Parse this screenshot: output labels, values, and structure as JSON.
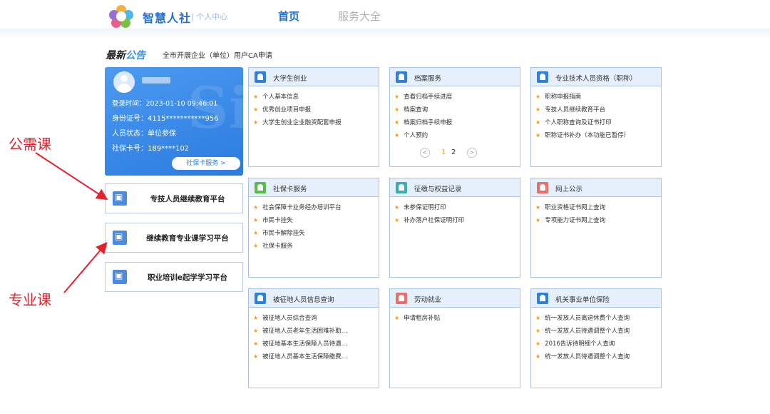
{
  "header": {
    "brand": "智慧人社",
    "sub": "| 个人中心",
    "nav_home": "首页",
    "nav_all": "服务大全"
  },
  "notice": {
    "title_a": "最新",
    "title_b": "公告",
    "text": "全市开展企业（单位）用户CA申请"
  },
  "user": {
    "login_time": "登录时间：2023-01-10 09:46:01",
    "id_no": "身份证号：4115***********956",
    "status": "人员状态：单位参保",
    "card_no": "社保卡号：189****102",
    "card_service": "社保卡服务 >"
  },
  "platforms": [
    "专技人员继续教育平台",
    "继续教育专业课学习平台",
    "职业培训e起学学习平台"
  ],
  "cards": [
    {
      "title": "大学生创业",
      "icon_color": "#2f7fd8",
      "items": [
        "个人基本信息",
        "优秀创业项目申报",
        "大学生创业企业融资配套申报"
      ]
    },
    {
      "title": "档案服务",
      "icon_color": "#2f7fd8",
      "items": [
        "查看归档手续进度",
        "档案查询",
        "档案归档手续申报",
        "个人预约"
      ],
      "pager": [
        "1",
        "2"
      ]
    },
    {
      "title": "专业技术人员资格（职称）",
      "icon_color": "#2f7fd8",
      "items": [
        "职称申报指南",
        "专技人员继续教育平台",
        "个人职称查询及证书打印",
        "职称证书补办（本功能已暂停）"
      ]
    },
    {
      "title": "社保卡服务",
      "icon_color": "#5bbb4a",
      "items": [
        "社会保障卡业务经办培训平台",
        "市民卡挂失",
        "市民卡解除挂失",
        "社保卡服务"
      ]
    },
    {
      "title": "征缴与权益记录",
      "icon_color": "#3aaeae",
      "items": [
        "未参保证明打印",
        "补办落户社保证明打印"
      ]
    },
    {
      "title": "网上公示",
      "icon_color": "#e9706a",
      "items": [
        "职业资格证书网上查询",
        "专项能力证书网上查询"
      ]
    },
    {
      "title": "被征地人员信息查询",
      "icon_color": "#2f7fd8",
      "items": [
        "被征地人员综合查询",
        "被征地人员老年生活困难补助...",
        "被征地基本生活保障人员待遇...",
        "被征地人员基本生活保障缴费..."
      ]
    },
    {
      "title": "劳动就业",
      "icon_color": "#e9706a",
      "items": [
        "申请租房补贴"
      ]
    },
    {
      "title": "机关事业单位保险",
      "icon_color": "#2f7fd8",
      "items": [
        "统一发放人员离退休费个人查询",
        "统一发放人员待遇调整个人查询",
        "2016告诉待明细个人查询",
        "统一发放人员待遇调整个人查询"
      ]
    }
  ],
  "annotations": {
    "public": "公需课",
    "major": "专业课"
  },
  "colors": {
    "accent": "#1f6fd6",
    "star": "#f29c1f",
    "annotation": "#e8202c"
  }
}
